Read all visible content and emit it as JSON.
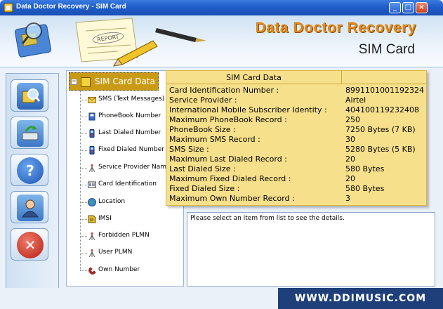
{
  "window": {
    "title": "Data Doctor Recovery - SIM Card",
    "minimize_label": "_",
    "maximize_label": "□",
    "close_label": "×"
  },
  "banner": {
    "brand": "Data Doctor Recovery",
    "product": "SIM Card",
    "report_text": "REPORT"
  },
  "nav": {
    "buttons": [
      {
        "name": "search-sim-button",
        "icon": "search-sim-icon"
      },
      {
        "name": "save-button",
        "icon": "save-icon"
      },
      {
        "name": "help-button",
        "icon": "help-icon",
        "glyph": "?"
      },
      {
        "name": "about-button",
        "icon": "user-icon"
      },
      {
        "name": "exit-button",
        "icon": "close-icon",
        "glyph": "✕"
      }
    ]
  },
  "tree": {
    "root_label": "SIM Card Data",
    "expander": "−",
    "items": [
      {
        "label": "SMS (Text Messages)",
        "icon": "envelope-icon"
      },
      {
        "label": "PhoneBook Number",
        "icon": "phonebook-icon"
      },
      {
        "label": "Last Dialed Number",
        "icon": "phone-icon"
      },
      {
        "label": "Fixed Dialed Number",
        "icon": "phone-icon"
      },
      {
        "label": "Service Provider Name",
        "icon": "antenna-icon"
      },
      {
        "label": "Card Identification",
        "icon": "id-card-icon"
      },
      {
        "label": "Location",
        "icon": "globe-icon"
      },
      {
        "label": "IMSI",
        "icon": "sim-icon"
      },
      {
        "label": "Forbidden PLMN",
        "icon": "antenna-icon"
      },
      {
        "label": "User PLMN",
        "icon": "antenna-icon"
      },
      {
        "label": "Own Number",
        "icon": "phone-icon"
      }
    ]
  },
  "sim_table": {
    "header": "SIM Card Data",
    "rows": [
      {
        "key": "Card Identification Number :",
        "value": "8991101001192324."
      },
      {
        "key": "Service Provider :",
        "value": "Airtel"
      },
      {
        "key": "International Mobile Subscriber Identity :",
        "value": "404100119232408"
      },
      {
        "key": "Maximum PhoneBook Record :",
        "value": "250"
      },
      {
        "key": "PhoneBook Size :",
        "value": "7250 Bytes (7 KB)"
      },
      {
        "key": "Maximum SMS Record :",
        "value": "30"
      },
      {
        "key": "SMS Size :",
        "value": "5280 Bytes (5 KB)"
      },
      {
        "key": "Maximum Last Dialed Record :",
        "value": "20"
      },
      {
        "key": "Last Dialed Size :",
        "value": "580 Bytes"
      },
      {
        "key": "Maximum Fixed Dialed Record :",
        "value": "20"
      },
      {
        "key": "Fixed Dialed Size :",
        "value": "580 Bytes"
      },
      {
        "key": "Maximum Own Number Record :",
        "value": "3"
      }
    ]
  },
  "details": {
    "message": "Please select an item from list to see the details."
  },
  "footer": {
    "website": "WWW.DDIMUSIC.COM"
  },
  "colors": {
    "brand_orange": "#e08a1d",
    "table_yellow": "#f7e08c",
    "selection_gold": "#c99b15",
    "footer_navy": "#1f3f7a"
  }
}
